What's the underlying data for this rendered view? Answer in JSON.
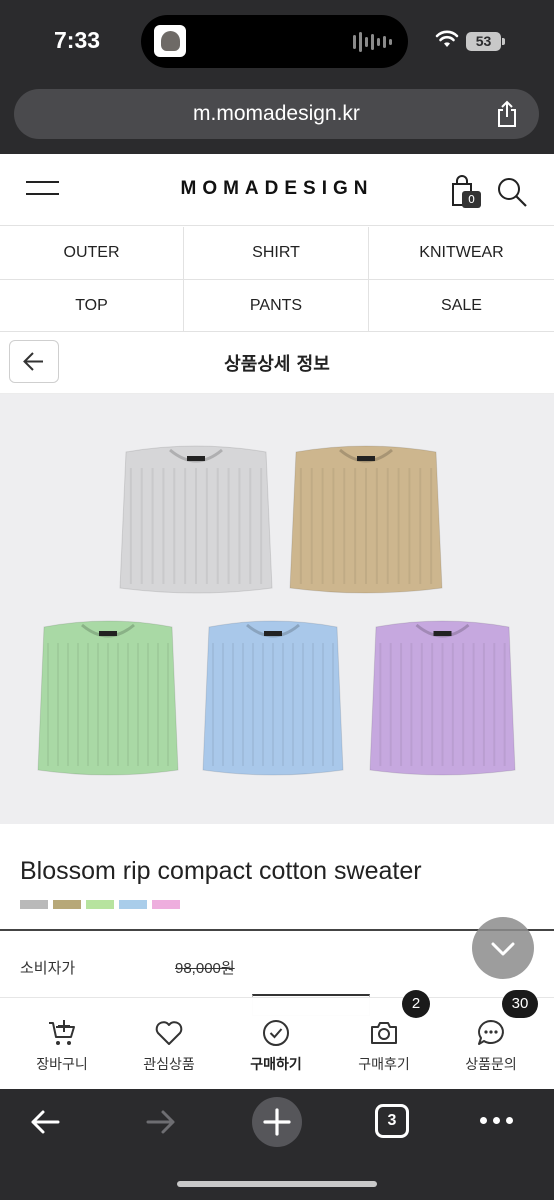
{
  "status_bar": {
    "time": "7:33",
    "battery": "53"
  },
  "browser": {
    "url": "m.momadesign.kr",
    "tab_count": "3"
  },
  "header": {
    "logo": "MOMADESIGN",
    "cart_count": "0"
  },
  "categories": [
    "OUTER",
    "SHIRT",
    "KNITWEAR",
    "TOP",
    "PANTS",
    "SALE"
  ],
  "detail": {
    "title": "상품상세 정보"
  },
  "product": {
    "name": "Blossom rip compact cotton sweater",
    "swatch_colors": [
      "#b9b9b9",
      "#b7a878",
      "#b7e39f",
      "#a9cdea",
      "#eeaede"
    ],
    "sweater_colors": [
      "#d6d6d8",
      "#cdb68e",
      "#a9d9a5",
      "#a9c8ea",
      "#c6a8df"
    ],
    "price_label": "소비자가",
    "price_value": "98,000원"
  },
  "action_bar": {
    "items": [
      {
        "label": "장바구니",
        "icon": "cart-plus-icon"
      },
      {
        "label": "관심상품",
        "icon": "heart-icon"
      },
      {
        "label": "구매하기",
        "icon": "check-circle-icon"
      },
      {
        "label": "구매후기",
        "icon": "camera-icon",
        "badge": "2"
      },
      {
        "label": "상품문의",
        "icon": "chat-icon",
        "badge": "30"
      }
    ]
  }
}
